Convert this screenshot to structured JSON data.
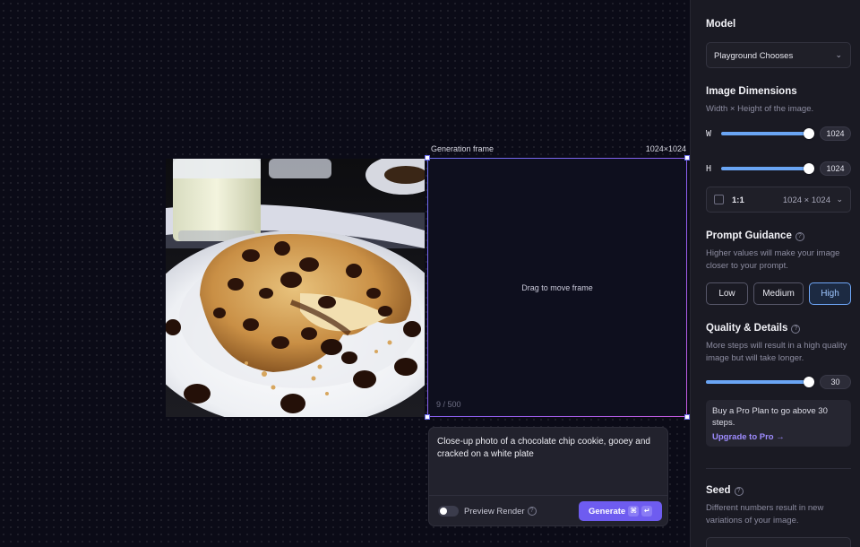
{
  "canvas": {
    "frame_label": "Generation frame",
    "frame_size": "1024×1024",
    "drag_hint": "Drag to move frame",
    "char_counter": "9 / 500",
    "prompt_text": "Close-up photo of a chocolate chip cookie, gooey and cracked on a white plate",
    "preview_label": "Preview Render",
    "generate_label": "Generate",
    "kbd_cmd": "⌘",
    "kbd_enter": "↵",
    "preview_enabled": false
  },
  "panel": {
    "model": {
      "title": "Model",
      "selected": "Playground Chooses"
    },
    "dimensions": {
      "title": "Image Dimensions",
      "subtitle": "Width × Height of the image.",
      "width_label": "W",
      "width_value": "1024",
      "height_label": "H",
      "height_value": "1024",
      "ratio_label": "1:1",
      "ratio_dims": "1024 × 1024"
    },
    "guidance": {
      "title": "Prompt Guidance",
      "subtitle": "Higher values will make your image closer to your prompt.",
      "options": [
        "Low",
        "Medium",
        "High"
      ],
      "selected": "High"
    },
    "quality": {
      "title": "Quality & Details",
      "subtitle": "More steps will result in a high quality image but will take longer.",
      "value": "30",
      "upsell_text": "Buy a Pro Plan to go above 30 steps.",
      "upsell_link": "Upgrade to Pro →"
    },
    "seed": {
      "title": "Seed",
      "subtitle": "Different numbers result in new variations of your image."
    }
  },
  "colors": {
    "accent": "#6e5cf0",
    "slider": "#6aa5f4",
    "selected_border": "#6ea6f7",
    "link": "#9e8cff"
  }
}
